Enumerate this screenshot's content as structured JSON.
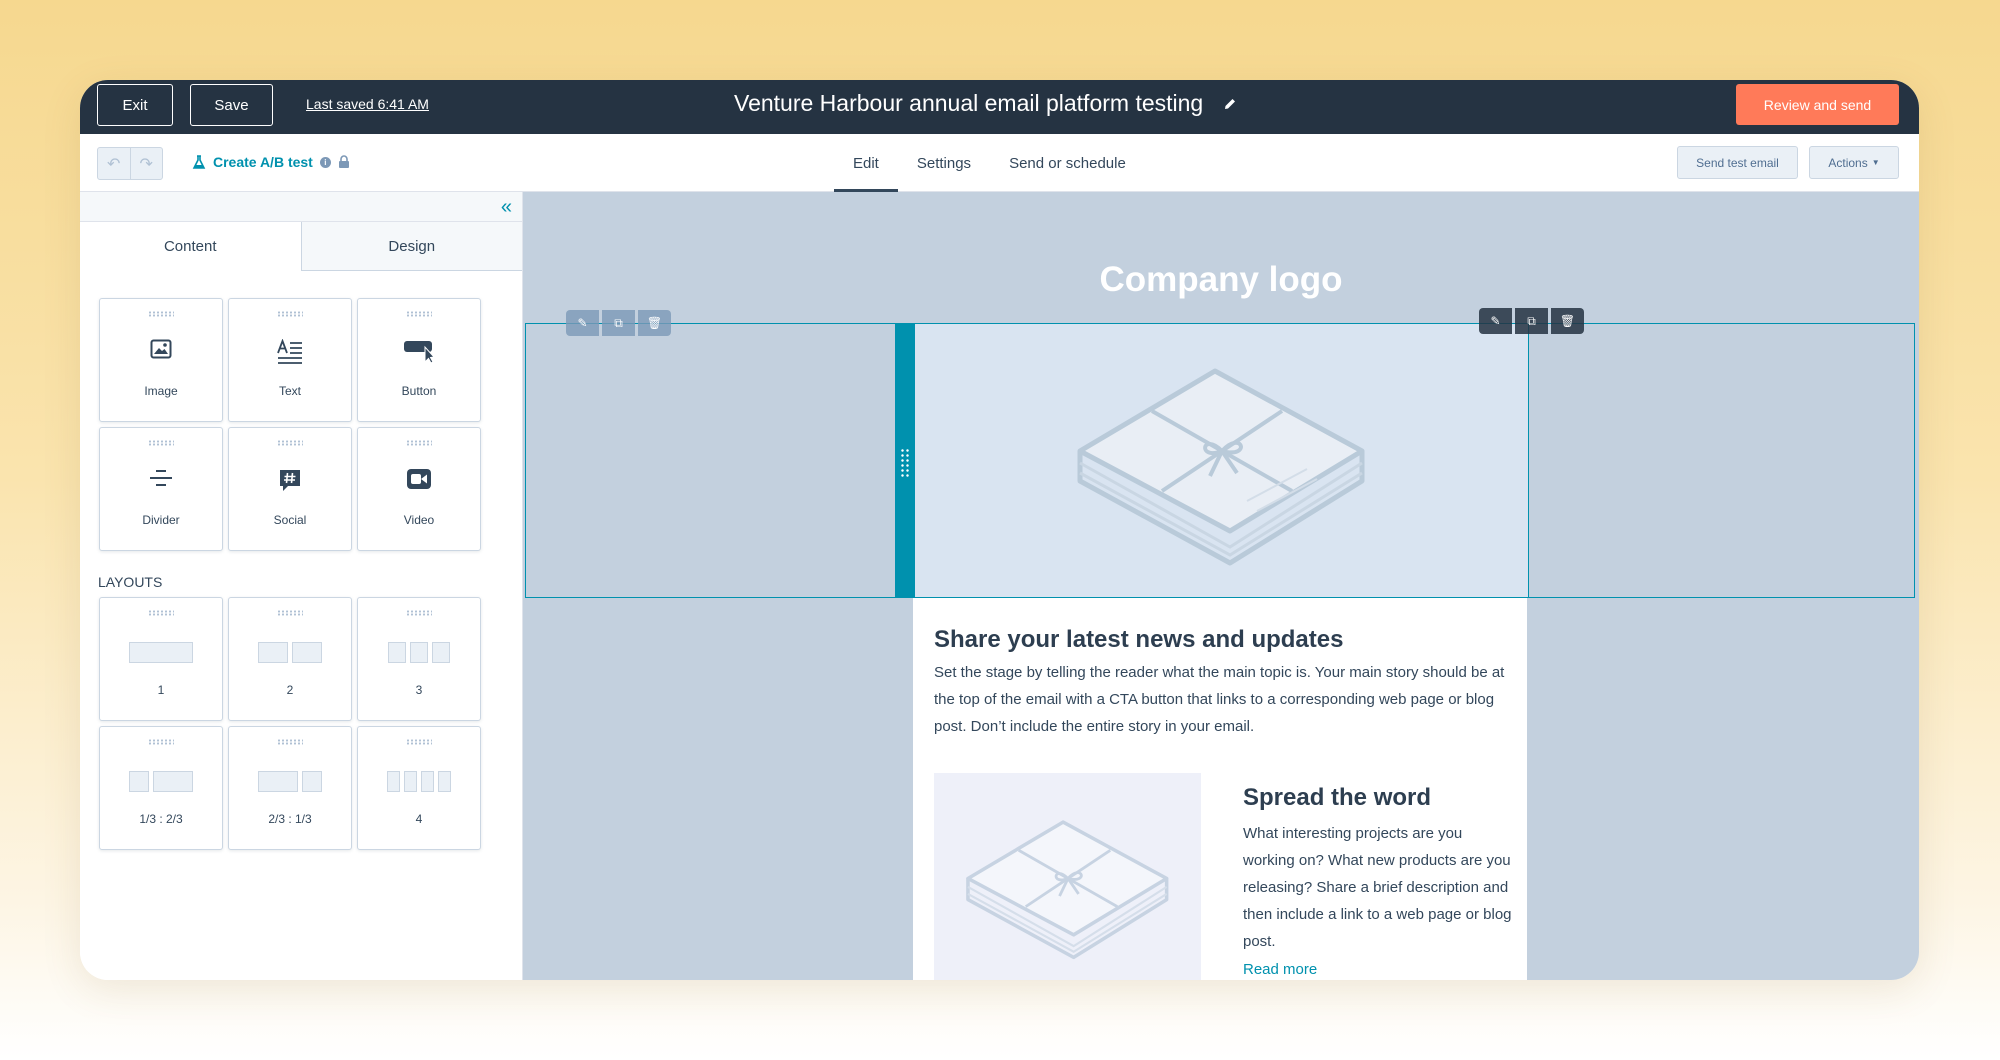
{
  "topbar": {
    "exit_label": "Exit",
    "save_label": "Save",
    "last_saved": "Last saved 6:41 AM",
    "title": "Venture Harbour annual email platform testing",
    "review_label": "Review and send",
    "review_color": "#ff7a59",
    "background": "#253342"
  },
  "toolbar": {
    "ab_test_label": "Create A/B test",
    "tabs": [
      {
        "label": "Edit",
        "active": true
      },
      {
        "label": "Settings",
        "active": false
      },
      {
        "label": "Send or schedule",
        "active": false
      }
    ],
    "send_test_label": "Send test email",
    "actions_label": "Actions"
  },
  "sidebar": {
    "tabs": [
      {
        "label": "Content",
        "active": true
      },
      {
        "label": "Design",
        "active": false
      }
    ],
    "modules": [
      {
        "label": "Image",
        "icon": "image-icon"
      },
      {
        "label": "Text",
        "icon": "text-icon"
      },
      {
        "label": "Button",
        "icon": "button-icon"
      },
      {
        "label": "Divider",
        "icon": "divider-icon"
      },
      {
        "label": "Social",
        "icon": "social-icon"
      },
      {
        "label": "Video",
        "icon": "video-icon"
      }
    ],
    "layouts_heading": "LAYOUTS",
    "layouts": [
      {
        "label": "1"
      },
      {
        "label": "2"
      },
      {
        "label": "3"
      },
      {
        "label": "1/3 : 2/3"
      },
      {
        "label": "2/3 : 1/3"
      },
      {
        "label": "4"
      }
    ]
  },
  "canvas": {
    "logo_text": "Company logo",
    "main_headline": "Share your latest news and updates",
    "main_paragraph": "Set the stage by telling the reader what the main topic is. Your main story should be at the top of the email with a CTA button that links to a corresponding web page or blog post. Don’t include the entire story in your email.",
    "side_headline": "Spread the word",
    "side_paragraph": "What interesting projects are you working on? What new products are you releasing? Share a brief description and then include a link to a web page or blog post.",
    "read_more": "Read more",
    "accent_color": "#0091ae",
    "background": "#c3d0de"
  }
}
